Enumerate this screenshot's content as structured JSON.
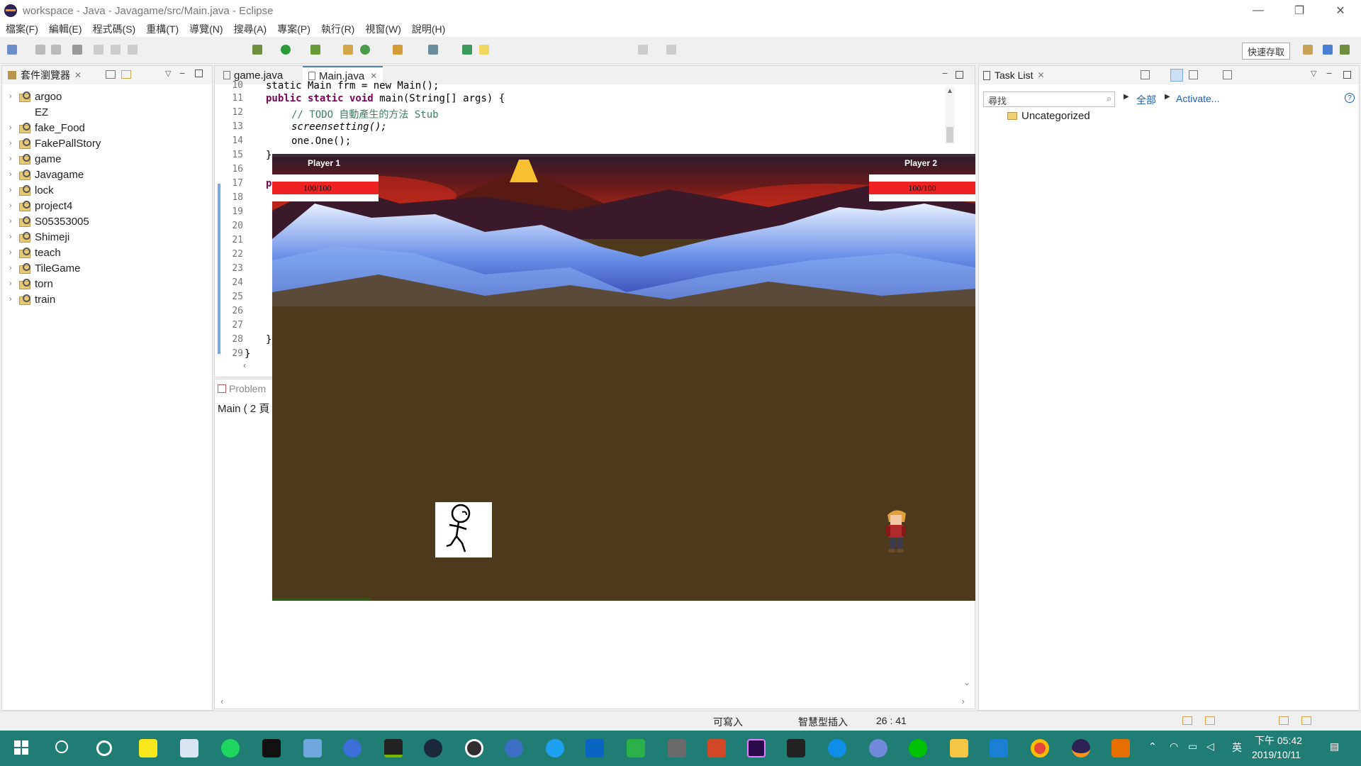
{
  "window": {
    "title": "workspace - Java - Javagame/src/Main.java - Eclipse",
    "controls": [
      "—",
      "❐",
      "✕"
    ]
  },
  "menu": [
    "檔案(F)",
    "編輯(E)",
    "程式碼(S)",
    "重構(T)",
    "導覽(N)",
    "搜尋(A)",
    "專案(P)",
    "執行(R)",
    "視窗(W)",
    "說明(H)"
  ],
  "toolbar": {
    "quick_access": "快速存取"
  },
  "package_explorer": {
    "title": "套件瀏覽器",
    "projects": [
      "argoo",
      "EZ",
      "fake_Food",
      "FakePallStory",
      "game",
      "Javagame",
      "lock",
      "project4",
      "S05353005",
      "Shimeji",
      "teach",
      "TileGame",
      "torn",
      "train"
    ]
  },
  "editor": {
    "tabs": [
      "game.java",
      "Main.java"
    ],
    "active_tab": "Main.java",
    "line_numbers": [
      "10",
      "11",
      "12",
      "13",
      "14",
      "15",
      "16",
      "17",
      "18",
      "19",
      "20",
      "21",
      "22",
      "23",
      "24",
      "25",
      "26",
      "27",
      "28",
      "29"
    ],
    "code": {
      "l10": "static Main frm = new Main();",
      "l11_a": "public static void ",
      "l11_b": "main(String[] args) {",
      "l12": "// TODO 自動產生的方法 Stub",
      "l13": "screensetting();",
      "l14": "one.One();",
      "l15": "}",
      "l17": "p",
      "l28": "}",
      "l29": "}"
    }
  },
  "problems": {
    "title": "Problem",
    "content": "Main ( 2 頁"
  },
  "task_list": {
    "title": "Task List",
    "search_placeholder": "尋找",
    "all_label": "全部",
    "activate_label": "Activate...",
    "category": "Uncategorized"
  },
  "status_bar": {
    "writable": "可寫入",
    "insert_mode": "智慧型插入",
    "position": "26 : 41"
  },
  "game": {
    "player1": {
      "name": "Player 1",
      "hp_text": "100/100",
      "hp_fraction": 1.0
    },
    "player2": {
      "name": "Player 2",
      "hp_text": "100/100",
      "hp_fraction": 1.0
    }
  },
  "taskbar": {
    "time": "下午 05:42",
    "date": "2019/10/11",
    "ime": "英",
    "icons": [
      "start-icon",
      "search-icon",
      "cortana-icon",
      "sticky-notes-icon",
      "photos-icon",
      "spotify-icon",
      "terminal-icon",
      "explorer-window-icon",
      "media-player-icon",
      "nvidia-icon",
      "steam-icon",
      "obs-icon",
      "edge-icon",
      "internet-explorer-icon",
      "outlook-icon",
      "qc-icon",
      "calculator-icon",
      "powerpoint-icon",
      "premiere-icon",
      "garena-icon",
      "teamviewer-icon",
      "discord-icon",
      "line-icon",
      "folder-icon",
      "vscode-icon",
      "chrome-icon",
      "eclipse-icon",
      "java-icon"
    ]
  },
  "colors": {
    "taskbar": "#1f7d73",
    "hp_red": "#ee2222",
    "ground": "#4d3a1d",
    "keyword": "#7f0055",
    "comment": "#3f7f5f",
    "link": "#1a5fb4"
  }
}
